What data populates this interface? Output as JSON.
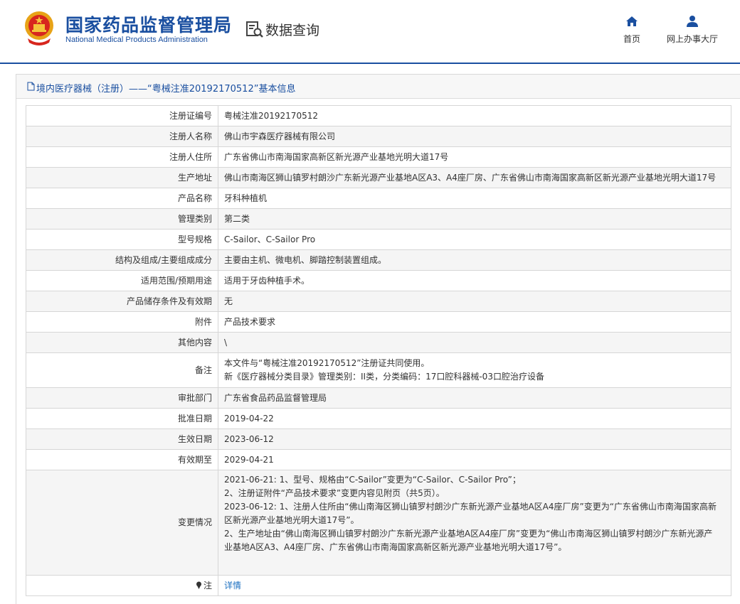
{
  "header": {
    "brand_cn": "国家药品监督管理局",
    "brand_en": "National Medical Products Administration",
    "query_title": "数据查询",
    "nav": {
      "home": "首页",
      "hall": "网上办事大厅"
    },
    "emblem_icon": "national-emblem-icon",
    "accent_color": "#1a4fa0"
  },
  "panel": {
    "title": "境内医疗器械（注册）——“粤械注准20192170512”基本信息"
  },
  "fields": [
    {
      "label": "注册证编号",
      "value": "粤械注准20192170512"
    },
    {
      "label": "注册人名称",
      "value": "佛山市宇森医疗器械有限公司"
    },
    {
      "label": "注册人住所",
      "value": "广东省佛山市南海国家高新区新光源产业基地光明大道17号"
    },
    {
      "label": "生产地址",
      "value": "佛山市南海区狮山镇罗村朗沙广东新光源产业基地A区A3、A4座厂房、广东省佛山市南海国家高新区新光源产业基地光明大道17号"
    },
    {
      "label": "产品名称",
      "value": "牙科种植机"
    },
    {
      "label": "管理类别",
      "value": "第二类"
    },
    {
      "label": "型号规格",
      "value": "C-Sailor、C-Sailor Pro"
    },
    {
      "label": "结构及组成/主要组成成分",
      "value": "主要由主机、微电机、脚踏控制装置组成。"
    },
    {
      "label": "适用范围/预期用途",
      "value": "适用于牙齿种植手术。"
    },
    {
      "label": "产品储存条件及有效期",
      "value": "无"
    },
    {
      "label": "附件",
      "value": "产品技术要求"
    },
    {
      "label": "其他内容",
      "value": "\\"
    },
    {
      "label": "备注",
      "lines": [
        "本文件与“粤械注准20192170512”注册证共同使用。",
        "新《医疗器械分类目录》管理类别：II类，分类编码：17口腔科器械-03口腔治疗设备"
      ]
    },
    {
      "label": "审批部门",
      "value": "广东省食品药品监督管理局"
    },
    {
      "label": "批准日期",
      "value": "2019-04-22"
    },
    {
      "label": "生效日期",
      "value": "2023-06-12"
    },
    {
      "label": "有效期至",
      "value": "2029-04-21"
    },
    {
      "label": "变更情况",
      "lines": [
        "2021-06-21: 1、型号、规格由“C-Sailor”变更为“C-Sailor、C-Sailor Pro”；",
        "2、注册证附件“产品技术要求”变更内容见附页（共5页）。",
        "2023-06-12: 1、注册人住所由“佛山南海区狮山镇罗村朗沙广东新光源产业基地A区A4座厂房”变更为“广东省佛山市南海国家高新",
        "区新光源产业基地光明大道17号”。",
        "2、生产地址由“佛山南海区狮山镇罗村朗沙广东新光源产业基地A区A4座厂房”变更为“佛山市南海区狮山镇罗村朗沙广东新光源产",
        "业基地A区A3、A4座厂房、广东省佛山市南海国家高新区新光源产业基地光明大道17号”。"
      ]
    },
    {
      "label": "注",
      "value": "详情"
    }
  ]
}
